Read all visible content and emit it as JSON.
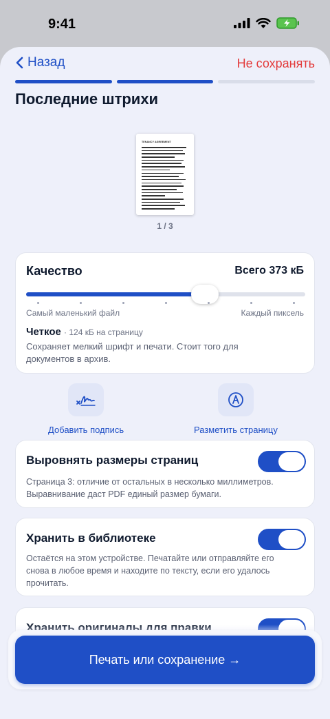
{
  "status_bar": {
    "time": "9:41"
  },
  "nav": {
    "back_label": "Назад",
    "discard_label": "Не сохранять"
  },
  "progress": {
    "total_steps": 3,
    "active_steps": 2
  },
  "page_title": "Последние штрихи",
  "preview": {
    "doc_title": "TENANCY AGREEMENT",
    "page_counter": "1 / 3"
  },
  "quality": {
    "title": "Качество",
    "total": "Всего 373 кБ",
    "slider_value_fraction": 0.64,
    "slider_steps": 7,
    "min_label": "Самый маленький файл",
    "max_label": "Каждый пиксель",
    "mode_name": "Четкое",
    "mode_detail": "· 124 кБ на страницу",
    "description": "Сохраняет мелкий шрифт и печати. Стоит того для документов в архив."
  },
  "tools": {
    "signature_label": "Добавить подпись",
    "markup_label": "Разметить страницу",
    "signature_icon": "signature-icon",
    "markup_icon": "pen-tip-icon"
  },
  "settings": [
    {
      "title": "Выровнять размеры страниц",
      "description": "Страница 3: отличие от остальных в несколько миллиметров. Выравнивание даст PDF единый размер бумаги.",
      "enabled": true
    },
    {
      "title": "Хранить в библиотеке",
      "description": "Остаётся на этом устройстве. Печатайте или отправляйте его снова в любое время и находите по тексту, если его удалось прочитать.",
      "enabled": true
    },
    {
      "title": "Хранить оригиналы для правки",
      "description": "",
      "enabled": true
    }
  ],
  "primary_action": "Печать или сохранение →",
  "colors": {
    "accent": "#1f4fc6",
    "danger": "#e33b3b",
    "background": "#eef0fa"
  }
}
